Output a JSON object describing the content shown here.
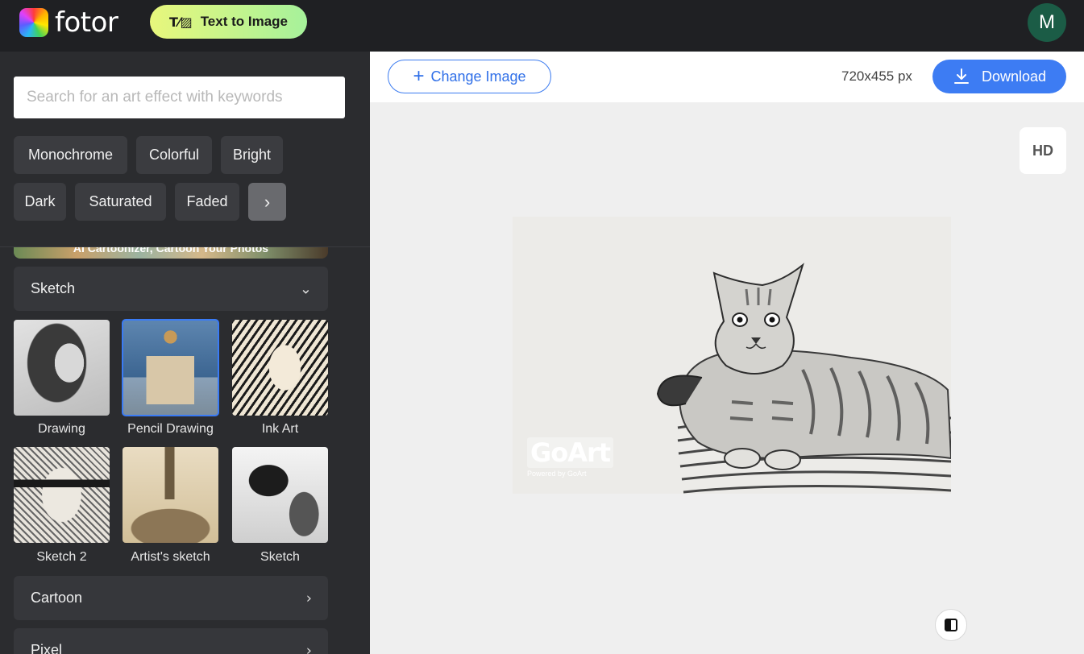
{
  "header": {
    "brand": "fotor",
    "text_to_image_label": "Text to Image",
    "avatar_initial": "M"
  },
  "sidebar": {
    "search_placeholder": "Search for an art effect with keywords",
    "chips": [
      "Monochrome",
      "Colorful",
      "Bright",
      "Dark",
      "Saturated",
      "Faded"
    ],
    "chips_more_glyph": "›",
    "promo_text": "AI Cartoonizer, Cartoon Your Photos",
    "sections": {
      "sketch": {
        "label": "Sketch",
        "expanded": true
      },
      "cartoon": {
        "label": "Cartoon"
      },
      "pixel": {
        "label": "Pixel"
      }
    },
    "effects": [
      {
        "label": "Drawing",
        "selected": false
      },
      {
        "label": "Pencil Drawing",
        "selected": true
      },
      {
        "label": "Ink Art",
        "selected": false
      },
      {
        "label": "Sketch 2",
        "selected": false
      },
      {
        "label": "Artist's sketch",
        "selected": false
      },
      {
        "label": "Sketch",
        "selected": false
      }
    ]
  },
  "toolbar": {
    "change_image_label": "Change Image",
    "dimensions": "720x455 px",
    "download_label": "Download",
    "hd_label": "HD"
  },
  "canvas": {
    "watermark": "GoArt",
    "watermark_sub": "Powered by GoArt"
  },
  "colors": {
    "accent": "#3d7cf3",
    "sidebar_bg": "#2b2c2f",
    "topbar_bg": "#1f2023",
    "avatar_bg": "#1b5c46"
  }
}
